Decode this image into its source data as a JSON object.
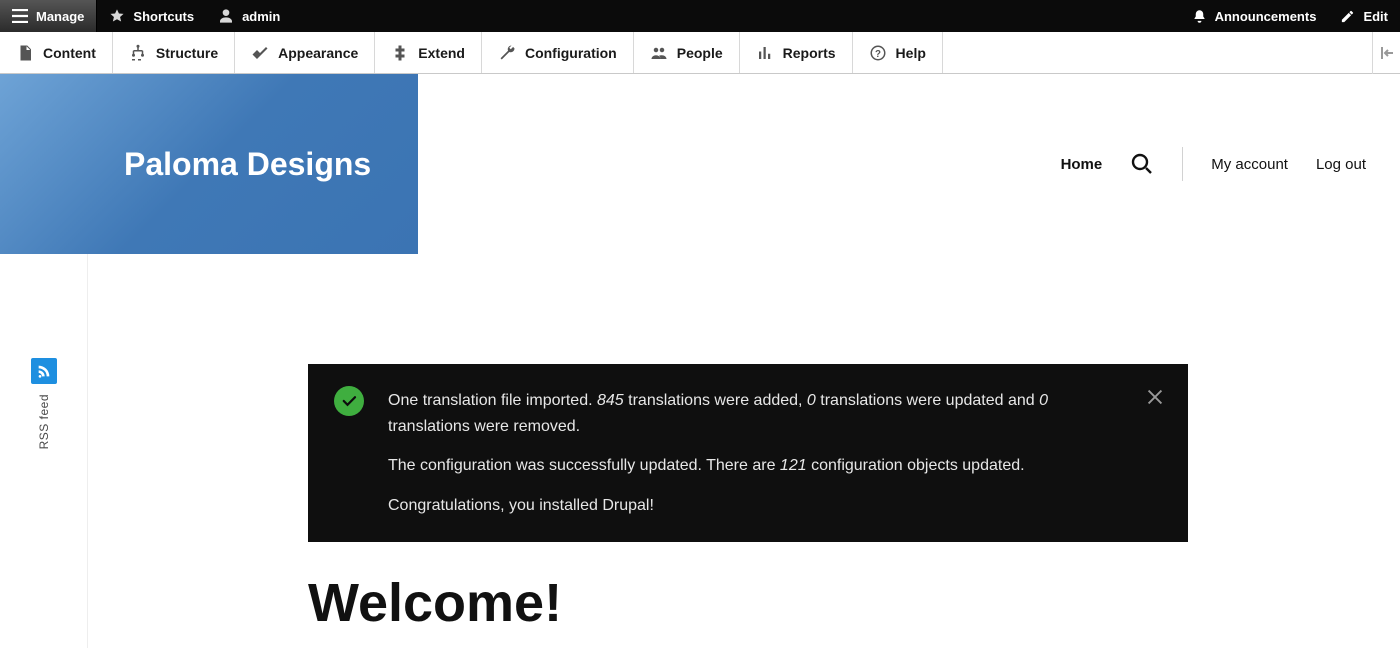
{
  "topbar": {
    "manage": "Manage",
    "shortcuts": "Shortcuts",
    "admin": "admin",
    "announcements": "Announcements",
    "edit": "Edit"
  },
  "adminmenu": {
    "items": [
      {
        "label": "Content"
      },
      {
        "label": "Structure"
      },
      {
        "label": "Appearance"
      },
      {
        "label": "Extend"
      },
      {
        "label": "Configuration"
      },
      {
        "label": "People"
      },
      {
        "label": "Reports"
      },
      {
        "label": "Help"
      }
    ]
  },
  "site": {
    "name": "Paloma Designs"
  },
  "nav": {
    "home": "Home",
    "my_account": "My account",
    "log_out": "Log out"
  },
  "sidebar": {
    "rss_label": "RSS feed"
  },
  "status": {
    "line1_pre": "One translation file imported. ",
    "line1_n1": "845",
    "line1_mid1": " translations were added, ",
    "line1_n2": "0",
    "line1_mid2": " translations were updated and ",
    "line1_n3": "0",
    "line1_post": " translations were removed.",
    "line2_pre": "The configuration was successfully updated. There are ",
    "line2_n": "121",
    "line2_post": " configuration objects updated.",
    "line3": "Congratulations, you installed Drupal!"
  },
  "page": {
    "title": "Welcome!"
  }
}
